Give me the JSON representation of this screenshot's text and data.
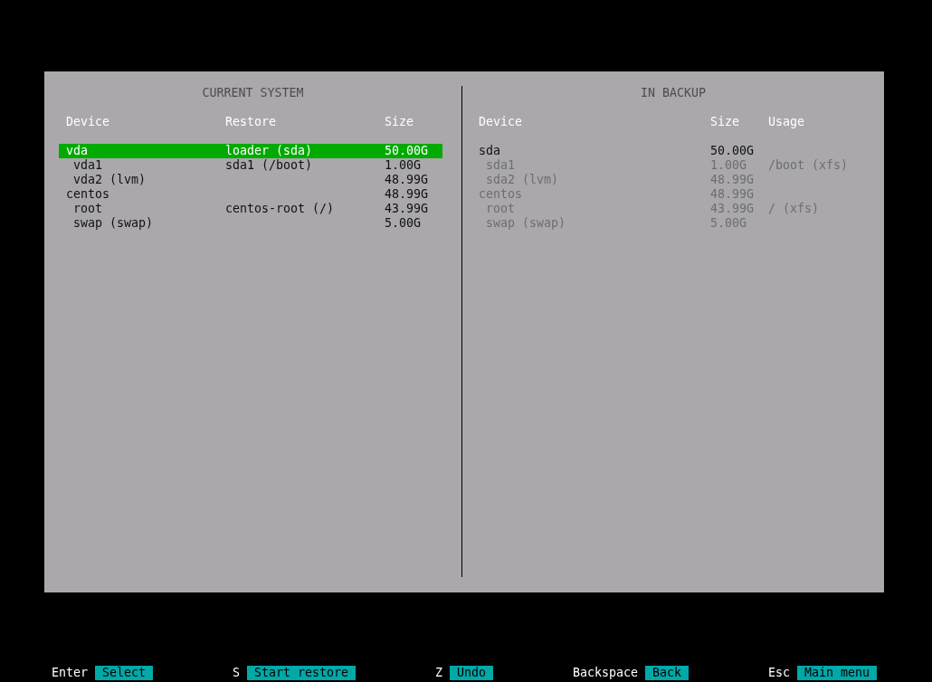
{
  "left_panel": {
    "title": "CURRENT SYSTEM",
    "columns": [
      "Device",
      "Restore",
      "Size"
    ],
    "rows": [
      {
        "device": "vda",
        "restore": "loader (sda)",
        "size": "50.00G",
        "selected": true,
        "children": [
          {
            "device": "vda1",
            "restore": "sda1 (/boot)",
            "size": "1.00G",
            "selected": false
          },
          {
            "device": "vda2 (lvm)",
            "size": "48.99G",
            "selected": false
          }
        ]
      },
      {
        "device": "centos",
        "size": "48.99G",
        "selected": false,
        "children": [
          {
            "device": "root",
            "restore": "centos-root (/)",
            "size": "43.99G",
            "selected": false
          },
          {
            "device": "swap (swap)",
            "size": "5.00G",
            "selected": false
          }
        ]
      }
    ]
  },
  "right_panel": {
    "title": "IN BACKUP",
    "columns": [
      "Device",
      "Size",
      "Usage"
    ],
    "rows": [
      {
        "device": "sda",
        "size": "50.00G",
        "dimmed": false,
        "children": [
          {
            "device": "sda1",
            "size": "1.00G",
            "usage": "/boot (xfs)",
            "dimmed": true
          },
          {
            "device": "sda2 (lvm)",
            "size": "48.99G",
            "dimmed": true
          }
        ]
      },
      {
        "device": "centos",
        "size": "48.99G",
        "dimmed": true,
        "children": [
          {
            "device": "root",
            "size": "43.99G",
            "usage": "/ (xfs)",
            "dimmed": true
          },
          {
            "device": "swap (swap)",
            "size": "5.00G",
            "dimmed": true
          }
        ]
      }
    ]
  },
  "shortcuts": [
    {
      "key": "Enter",
      "label": "Select"
    },
    {
      "key": "S",
      "label": "Start restore"
    },
    {
      "key": "Z",
      "label": "Undo"
    },
    {
      "key": "Backspace",
      "label": "Back"
    },
    {
      "key": "Esc",
      "label": "Main menu"
    }
  ]
}
